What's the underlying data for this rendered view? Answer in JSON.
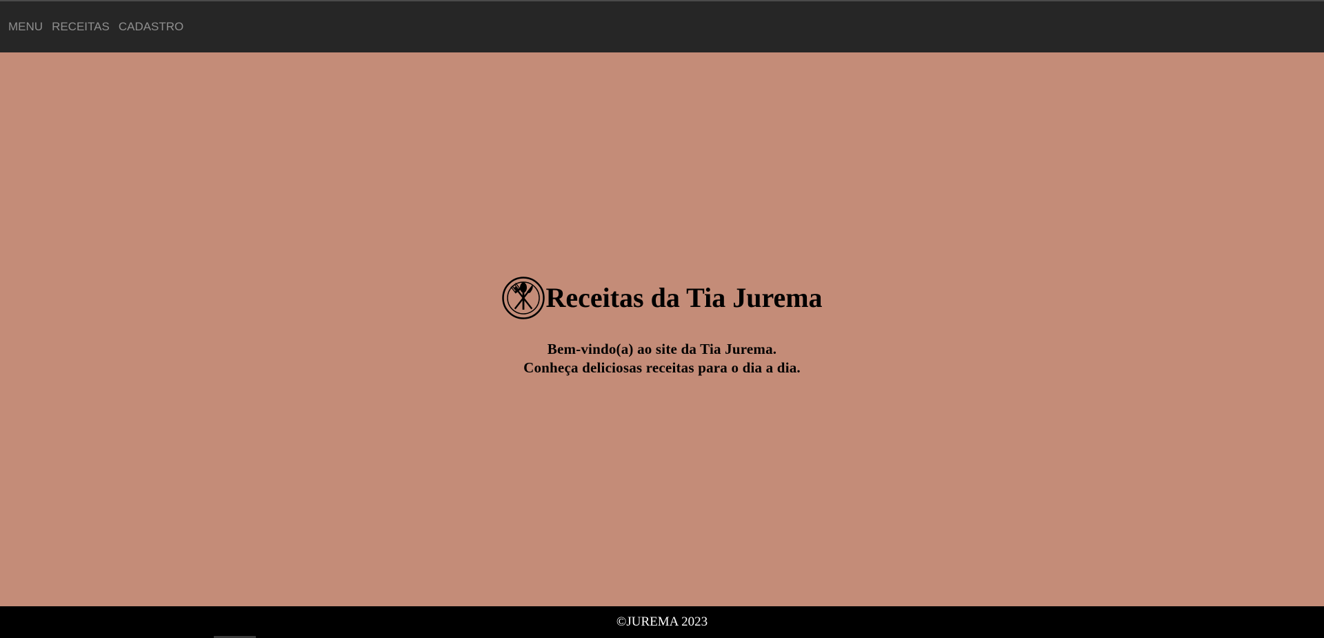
{
  "nav": {
    "items": [
      {
        "label": "MENU"
      },
      {
        "label": "RECEITAS"
      },
      {
        "label": "CADASTRO"
      }
    ]
  },
  "hero": {
    "logo_icon": "plate-cutlery-icon",
    "title": "Receitas da Tia Jurema",
    "welcome_line1": "Bem-vindo(a) ao site da Tia Jurema.",
    "welcome_line2": "Conheça deliciosas receitas para o dia a dia."
  },
  "footer": {
    "copyright": "©JUREMA 2023"
  },
  "colors": {
    "page_background": "#c48c78",
    "header_background": "#262626",
    "nav_text": "#8f8f8f",
    "footer_background": "#000000",
    "footer_text": "#ffffff"
  }
}
